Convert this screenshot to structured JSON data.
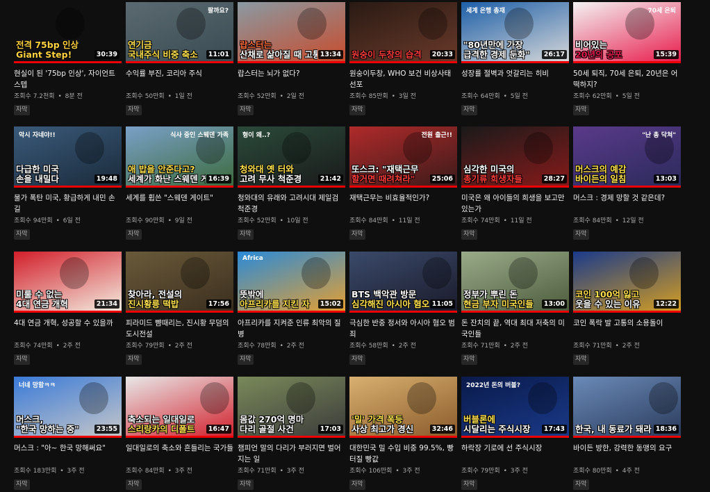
{
  "videos": [
    {
      "title": "현실이 된 '75bp 인상', 자이언트 스텝",
      "views": "조회수 7.2천회",
      "age": "8분 전",
      "duration": "30:39",
      "cap1": "전격 75bp 인상",
      "cap2": "Giant Step!",
      "c1": "#ffd23f",
      "c2": "#ffd23f",
      "bg": "linear-gradient(135deg,#1a1a1a,#444 60,#222)",
      "bg2": "#2b2b2b",
      "top": "",
      "captions": "자막"
    },
    {
      "title": "수익률 부진, 코리아 주식",
      "views": "조회수 50만회",
      "age": "1일 전",
      "duration": "11:01",
      "cap1": "연기금",
      "cap2": "국내주식 비중 축소",
      "c1": "#ffe14d",
      "c2": "#ffe14d",
      "bg": "#5a6a70",
      "bg2": "#3a4a52",
      "top": "팔까요?",
      "captions": "자막"
    },
    {
      "title": "랍스터는 뇌가 없다?",
      "views": "조회수 52만회",
      "age": "2일 전",
      "duration": "13:34",
      "cap1": "랍스터는",
      "cap2": "산채로 삶아질 때 고통을 느낄까",
      "c1": "#ff6a3d",
      "c2": "#ffffff",
      "bg": "#8a9aa3",
      "bg2": "#c94a2a",
      "top": "",
      "captions": "자막"
    },
    {
      "title": "원숭이두창, WHO 보건 비상사태 선포",
      "views": "조회수 85만회",
      "age": "3일 전",
      "duration": "20:33",
      "cap1": "",
      "cap2": "원숭이 두창의 습격",
      "c1": "#ff3b3b",
      "c2": "#ff3b3b",
      "bg": "#2a1a14",
      "bg2": "#6a3a2a",
      "top": "",
      "captions": "자막"
    },
    {
      "title": "성장률 절벽과 엇갈리는 히비",
      "views": "조회수 64만회",
      "age": "5일 전",
      "duration": "26:17",
      "cap1": "\"80년만에 가장",
      "cap2": "급격한 경제 둔화\"",
      "c1": "#ffffff",
      "c2": "#ffffff",
      "bg": "#1d5fa8",
      "bg2": "#d9d9d9",
      "top": "세계 은행 총재",
      "captions": "자막"
    },
    {
      "title": "50세 퇴직, 70세 은퇴, 20년은 어떡하지?",
      "views": "조회수 62만회",
      "age": "5일 전",
      "duration": "15:39",
      "cap1": "비어있는",
      "cap2": "20년의 공포",
      "c1": "#ffffff",
      "c2": "#e8194a",
      "bg": "#f3f3f3",
      "bg2": "#e8194a",
      "top": "70세 은퇴",
      "captions": "자막"
    },
    {
      "title": "물가 폭탄 미국, 황급하게 내민 손길",
      "views": "조회수 94만회",
      "age": "6일 전",
      "duration": "19:48",
      "cap1": "다급한 미국",
      "cap2": "손을 내밀다",
      "c1": "#ffffff",
      "c2": "#ffffff",
      "bg": "#3a5a7a",
      "bg2": "#1a2a3a",
      "top": "악시 자네야!!",
      "captions": "자막"
    },
    {
      "title": "세계를 휩쓴 \"스웨덴 게이트\"",
      "views": "조회수 90만회",
      "age": "9일 전",
      "duration": "16:39",
      "cap1": "애 밥을 안준다고?",
      "cap2": "세계가 화난 스웨덴 게이트",
      "c1": "#ffe14d",
      "c2": "#ffffff",
      "bg": "#7aa0c8",
      "bg2": "#3a6a3a",
      "top": "식사 중인 스웨덴 가족",
      "captions": "자막"
    },
    {
      "title": "청와대의 유래와 고려시대 제일검 척준경",
      "views": "조회수 52만회",
      "age": "10일 전",
      "duration": "21:42",
      "cap1": "청와대 옛 터와",
      "cap2": "고려 무사 척준경",
      "c1": "#ffe14d",
      "c2": "#ffffff",
      "bg": "#2a4a3a",
      "bg2": "#1a1a1a",
      "top": "형이 왜..?",
      "captions": "자막"
    },
    {
      "title": "재택근무는 비효율적인가?",
      "views": "조회수 84만회",
      "age": "11일 전",
      "duration": "25:06",
      "cap1": "또스크: \"재택근무",
      "cap2": "할거면 때려쳐라\"",
      "c1": "#ffffff",
      "c2": "#ff3b3b",
      "bg": "#b02a2a",
      "bg2": "#3a1a1a",
      "top": "전원 출근!!",
      "captions": "자막"
    },
    {
      "title": "미국은 왜 아이들의 희생을 보고만 있는가",
      "views": "조회수 74만회",
      "age": "11일 전",
      "duration": "28:27",
      "cap1": "심각한 미국의",
      "cap2": "총기류 희생자들",
      "c1": "#ffffff",
      "c2": "#ff3b3b",
      "bg": "#1a1a1a",
      "bg2": "#8a1a1a",
      "top": "",
      "captions": "자막"
    },
    {
      "title": "머스크 : 경제 망할 것 같은데?",
      "views": "조회수 84만회",
      "age": "12일 전",
      "duration": "13:03",
      "cap1": "머스크의 예감",
      "cap2": "바이든의 일침",
      "c1": "#ffe14d",
      "c2": "#ffe14d",
      "bg": "#5a3a8a",
      "bg2": "#2a2a5a",
      "top": "\"난 총 닥쳐\"",
      "captions": "자막"
    },
    {
      "title": "4대 연금 개혁, 성공할 수 있을까",
      "views": "조회수 74만회",
      "age": "2주 전",
      "duration": "21:34",
      "cap1": "미룰 수 없는",
      "cap2": "4대 연금 개혁",
      "c1": "#ffffff",
      "c2": "#ffffff",
      "bg": "#d21e2a",
      "bg2": "#f4efe2",
      "top": "",
      "captions": "자막"
    },
    {
      "title": "피라미드 뺨때리는, 진시황 무덤의 도시전설",
      "views": "조회수 79만회",
      "age": "2주 전",
      "duration": "17:56",
      "cap1": "찾아라, 전설의",
      "cap2": "진시황릉 떡밥",
      "c1": "#ffffff",
      "c2": "#ffe14d",
      "bg": "#6a5a3a",
      "bg2": "#3a2e1e",
      "top": "",
      "captions": "자막"
    },
    {
      "title": "아프리카를 지켜준 인류 최악의 질병",
      "views": "조회수 78만회",
      "age": "2주 전",
      "duration": "15:02",
      "cap1": "뜻밖에",
      "cap2": "아프리카를 지킨 자",
      "c1": "#ffffff",
      "c2": "#ffe14d",
      "bg": "#2a8ad8",
      "bg2": "#e8a030",
      "top": "Africa",
      "captions": "자막"
    },
    {
      "title": "극심한 반중 정서와 아시아 혐오 범죄",
      "views": "조회수 58만회",
      "age": "2주 전",
      "duration": "11:05",
      "cap1": "BTS 백악관 방문",
      "cap2": "심각해진 아시아 혐오",
      "c1": "#ffffff",
      "c2": "#ffe14d",
      "bg": "#3a4a6a",
      "bg2": "#1a1a2a",
      "top": "",
      "captions": "자막"
    },
    {
      "title": "돈 잔치의 끝, 역대 최대 저축의 미국인들",
      "views": "조회수 71만회",
      "age": "2주 전",
      "duration": "13:00",
      "cap1": "정부가 뿌린 돈",
      "cap2": "현금 부자 미국인들",
      "c1": "#ffffff",
      "c2": "#ffe14d",
      "bg": "#9aab8a",
      "bg2": "#4a5a3a",
      "top": "",
      "captions": "자막"
    },
    {
      "title": "코인 폭락 발 고통의 소용돌이",
      "views": "조회수 71만회",
      "age": "2주 전",
      "duration": "12:22",
      "cap1": "코인 100억 잃고",
      "cap2": "웃을 수 있는 이유",
      "c1": "#ffe14d",
      "c2": "#ffffff",
      "bg": "#1a3a8a",
      "bg2": "#d8a020",
      "top": "",
      "captions": "자막"
    },
    {
      "title": "머스크 : \"아~ 한국 망해써요\"",
      "views": "조회수 183만회",
      "age": "3주 전",
      "duration": "23:55",
      "cap1": "머스크,",
      "cap2": "\"한국 망하는 중\"",
      "c1": "#ffffff",
      "c2": "#ffffff",
      "bg": "#3a7ad8",
      "bg2": "#c8c8c8",
      "top": "너네 망함ㅋㅋ",
      "captions": "자막"
    },
    {
      "title": "일대일로의 축소와 흔들리는 국가들",
      "views": "조회수 84만회",
      "age": "3주 전",
      "duration": "16:47",
      "cap1": "축소되는 일대일로",
      "cap2": "스리랑카의 디폴트",
      "c1": "#ffffff",
      "c2": "#ffe14d",
      "bg": "#e8e8e8",
      "bg2": "#d21e2a",
      "top": "",
      "captions": "자막"
    },
    {
      "title": "챔피언 말의 다리가 부러지면 벌어지는 일",
      "views": "조회수 71만회",
      "age": "3주 전",
      "duration": "17:03",
      "cap1": "몸값 270억 명마",
      "cap2": "다리 골절 사건",
      "c1": "#ffffff",
      "c2": "#ffffff",
      "bg": "#7a8a5a",
      "bg2": "#3a3a3a",
      "top": "",
      "captions": "자막"
    },
    {
      "title": "대한민국 밀 수입 비중 99.5%, 빵터질 빵값",
      "views": "조회수 106만회",
      "age": "3주 전",
      "duration": "32:46",
      "cap1": "'밀' 가격 폭등",
      "cap2": "사상 최고가 경신",
      "c1": "#ffe14d",
      "c2": "#ffffff",
      "bg": "#d8b070",
      "bg2": "#8a5a2a",
      "top": "",
      "captions": "자막"
    },
    {
      "title": "하락장 기로에 선 주식시장",
      "views": "조회수 79만회",
      "age": "3주 전",
      "duration": "17:43",
      "cap1": "버블론에",
      "cap2": "시달리는 주식시장",
      "c1": "#ffe14d",
      "c2": "#ffffff",
      "bg": "#0a1a4a",
      "bg2": "#1a3a8a",
      "top": "2022년 돈의 버블?",
      "captions": "자막"
    },
    {
      "title": "바이든 방한, 강력한 동맹의 요구",
      "views": "조회수 80만회",
      "age": "4주 전",
      "duration": "18:36",
      "cap1": "",
      "cap2": "한국, 내 동료가 돼라",
      "c1": "#ffffff",
      "c2": "#ffffff",
      "bg": "#6a8ab8",
      "bg2": "#2a3a5a",
      "top": "",
      "captions": "자막"
    }
  ],
  "meta_separator": "•"
}
